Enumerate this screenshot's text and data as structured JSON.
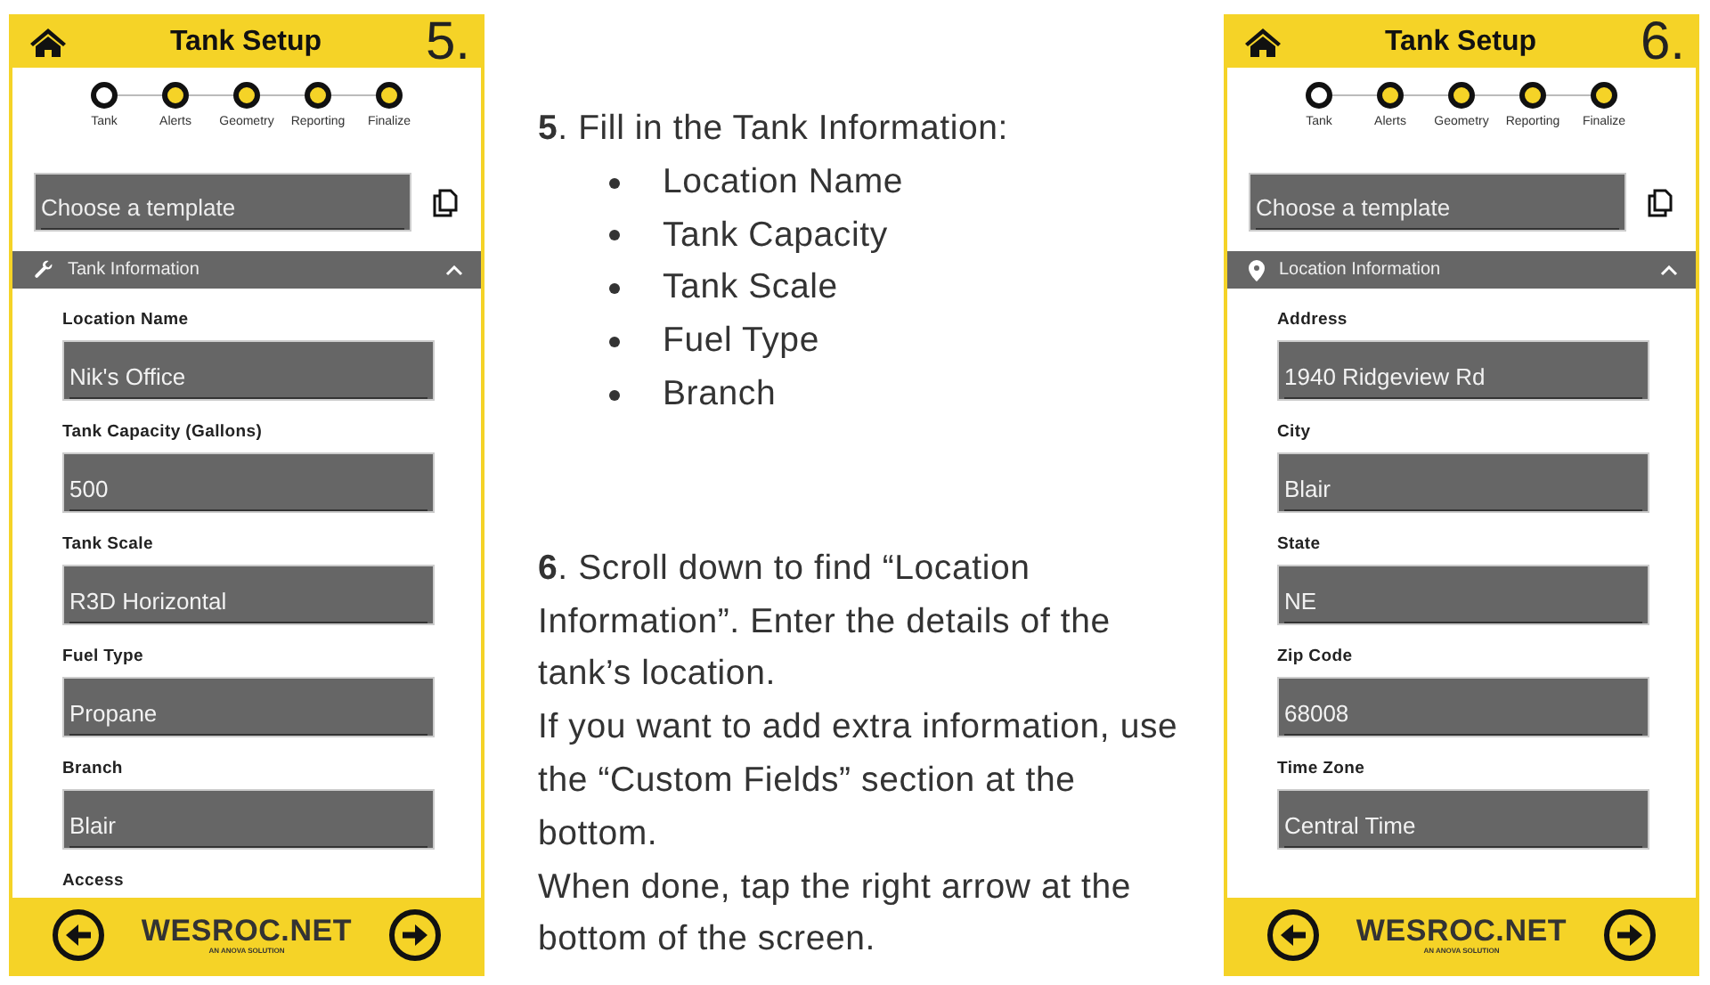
{
  "panels": [
    {
      "title": "Tank Setup",
      "step_number": "5.",
      "steps": [
        {
          "label": "Tank",
          "selected": true
        },
        {
          "label": "Alerts",
          "selected": false
        },
        {
          "label": "Geometry",
          "selected": false
        },
        {
          "label": "Reporting",
          "selected": false
        },
        {
          "label": "Finalize",
          "selected": false
        }
      ],
      "template": {
        "placeholder": "Choose a template"
      },
      "section": {
        "kind": "wrench",
        "title": "Tank Information",
        "expanded": true
      },
      "fields": [
        {
          "label": "Location Name",
          "value": "Nik's Office"
        },
        {
          "label": "Tank Capacity (Gallons)",
          "value": "500"
        },
        {
          "label": "Tank Scale",
          "value": "R3D Horizontal"
        },
        {
          "label": "Fuel Type",
          "value": "Propane"
        },
        {
          "label": "Branch",
          "value": "Blair"
        }
      ],
      "trailing_label": "Access",
      "brand": "WESROC.NET",
      "tagline": "AN ANOVA SOLUTION"
    },
    {
      "title": "Tank Setup",
      "step_number": "6.",
      "steps": [
        {
          "label": "Tank",
          "selected": true
        },
        {
          "label": "Alerts",
          "selected": false
        },
        {
          "label": "Geometry",
          "selected": false
        },
        {
          "label": "Reporting",
          "selected": false
        },
        {
          "label": "Finalize",
          "selected": false
        }
      ],
      "template": {
        "placeholder": "Choose a template"
      },
      "section": {
        "kind": "pin",
        "title": "Location Information",
        "expanded": true
      },
      "fields": [
        {
          "label": "Address",
          "value": "1940 Ridgeview Rd"
        },
        {
          "label": "City",
          "value": "Blair"
        },
        {
          "label": "State",
          "value": "NE"
        },
        {
          "label": "Zip Code",
          "value": "68008"
        },
        {
          "label": "Time Zone",
          "value": "Central Time"
        }
      ],
      "brand": "WESROC.NET",
      "tagline": "AN ANOVA SOLUTION"
    }
  ],
  "instructions": [
    {
      "paragraphs": [
        "**5**. Fill in the Tank Information:"
      ],
      "bullets": [
        "Location Name",
        "Tank Capacity",
        "Tank Scale",
        "Fuel Type",
        "Branch"
      ]
    },
    {
      "paragraphs": [
        "**6**. Scroll down to find “Location Information”. Enter the details of the tank’s location.",
        "If you want to add extra information, use the “Custom Fields” section at the bottom.",
        "When done, tap the right arrow at the bottom of the screen."
      ]
    }
  ]
}
